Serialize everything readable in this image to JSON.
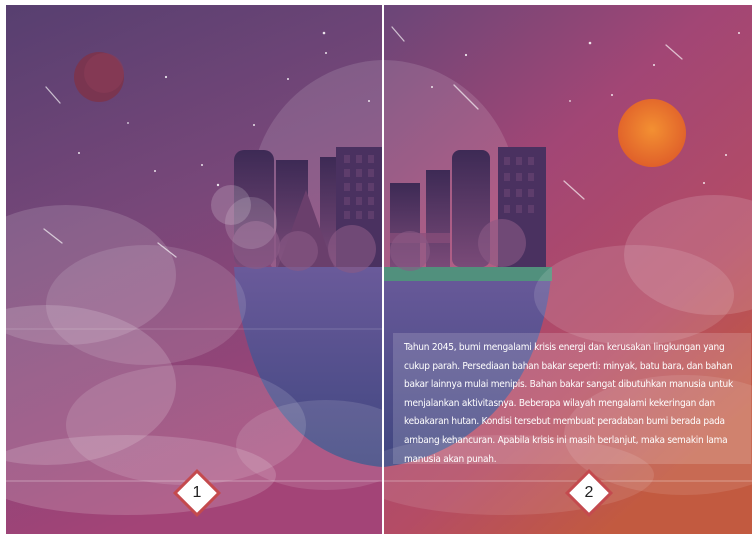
{
  "pages": [
    {
      "number": "1"
    },
    {
      "number": "2"
    }
  ],
  "story_text": "Tahun 2045, bumi mengalami krisis energi dan kerusakan lingkungan yang cukup parah. Persediaan bahan bakar seperti: minyak, batu bara, dan bahan bakar lainnya mulai menipis. Bahan bakar sangat dibutuhkan manusia untuk menjalankan aktivitasnya. Beberapa wilayah mengalami kekeringan dan kebakaran hutan. Kondisi tersebut membuat peradaban bumi berada pada ambang kehancuran. Apabila krisis ini masih berlanjut, maka semakin lama manusia akan punah.",
  "colors": {
    "sky_top": "#5a3f72",
    "sky_bottom_left": "#9a3f78",
    "sky_bottom_right": "#c0584a",
    "water": "#4b4a86",
    "grass": "#4d9a78",
    "sun": "#e8742e",
    "planet_left": "#7a3550",
    "badge_border": "#c44a4e"
  }
}
